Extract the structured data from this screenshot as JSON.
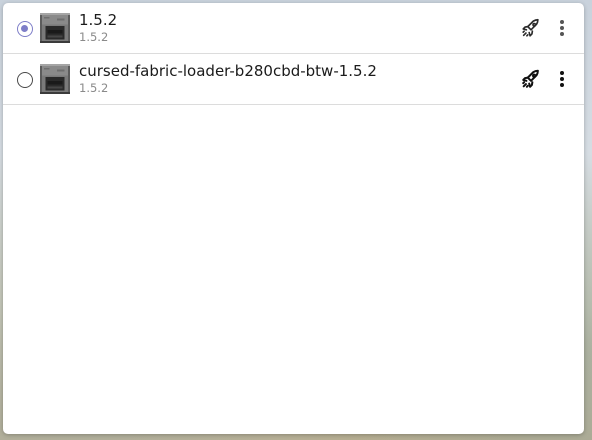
{
  "instances": [
    {
      "title": "1.5.2",
      "subtitle": "1.5.2",
      "selected": true,
      "icon": "furnace-icon",
      "launch_icon": "rocket-icon",
      "menu_icon": "kebab-menu-icon"
    },
    {
      "title": "cursed-fabric-loader-b280cbd-btw-1.5.2",
      "subtitle": "1.5.2",
      "selected": false,
      "icon": "furnace-icon",
      "launch_icon": "rocket-icon",
      "menu_icon": "kebab-menu-icon"
    }
  ],
  "colors": {
    "radio_selected": "#7e7ec8",
    "title_text": "#1b1b1b",
    "subtitle_text": "#8a8a8a"
  }
}
